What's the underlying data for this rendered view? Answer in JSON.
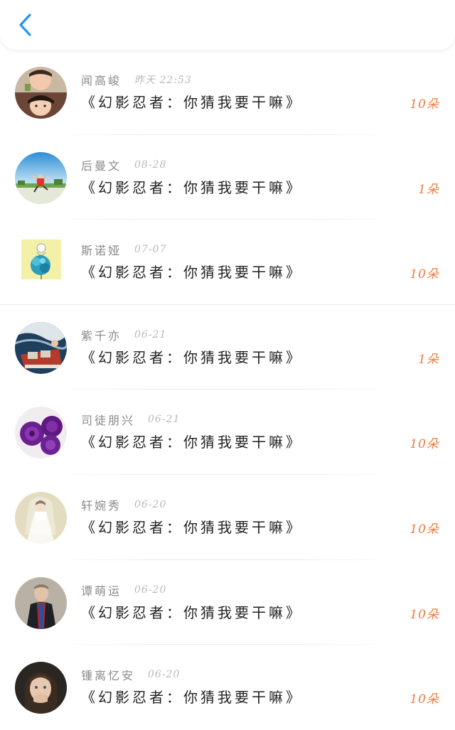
{
  "header": {
    "back_icon": "chevron-left-icon",
    "accent": "#2196f3"
  },
  "colors": {
    "count": "#f07a3e",
    "name": "#8a8a8a",
    "time": "#b8b8b8",
    "title": "#222222"
  },
  "messages": [
    {
      "name": "闻高峻",
      "time": "昨天 22:53",
      "title": "《幻影忍者：你猜我要干嘛》",
      "count": "10朵",
      "avatar": "avatar-two-children"
    },
    {
      "name": "后曼文",
      "time": "08-28",
      "title": "《幻影忍者：你猜我要干嘛》",
      "count": "1朵",
      "avatar": "avatar-jumping-person-sky"
    },
    {
      "name": "斯诺娅",
      "time": "07-07",
      "title": "《幻影忍者：你猜我要干嘛》",
      "count": "10朵",
      "avatar": "avatar-drawing-blue-flower"
    },
    {
      "name": "紫千亦",
      "time": "06-21",
      "title": "《幻影忍者：你猜我要干嘛》",
      "count": "1朵",
      "avatar": "avatar-boat-on-water"
    },
    {
      "name": "司徒朋兴",
      "time": "06-21",
      "title": "《幻影忍者：你猜我要干嘛》",
      "count": "10朵",
      "avatar": "avatar-purple-roses"
    },
    {
      "name": "轩婉秀",
      "time": "06-20",
      "title": "《幻影忍者：你猜我要干嘛》",
      "count": "10朵",
      "avatar": "avatar-bride"
    },
    {
      "name": "谭萌运",
      "time": "06-20",
      "title": "《幻影忍者：你猜我要干嘛》",
      "count": "10朵",
      "avatar": "avatar-man-scarf"
    },
    {
      "name": "锺离忆安",
      "time": "06-20",
      "title": "《幻影忍者：你猜我要干嘛》",
      "count": "10朵",
      "avatar": "avatar-child-portrait"
    }
  ]
}
